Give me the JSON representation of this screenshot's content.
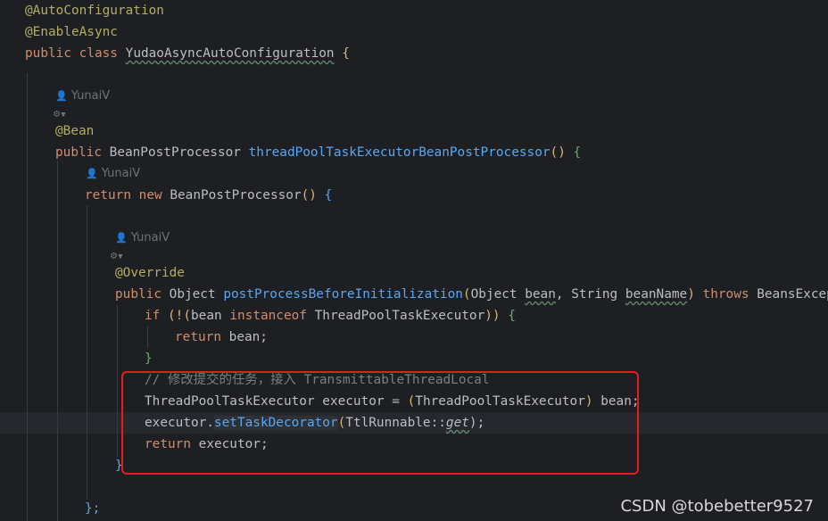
{
  "editor": {
    "hints": {
      "author": "YunaiV"
    },
    "code": {
      "ann_autoconfig": "@AutoConfiguration",
      "ann_enableasync": "@EnableAsync",
      "kw_public": "public",
      "kw_class": "class",
      "class_name": "YudaoAsyncAutoConfiguration",
      "brace_open": "{",
      "ann_bean": "@Bean",
      "type_bpp": "BeanPostProcessor",
      "method_name": "threadPoolTaskExecutorBeanPostProcessor",
      "paren_pair": "()",
      "kw_return": "return",
      "kw_new": "new",
      "ann_override": "@Override",
      "type_object": "Object",
      "method_post": "postProcessBeforeInitialization",
      "paren_open": "(",
      "param_type1": "Object",
      "param_bean": "bean",
      "comma": ",",
      "param_type2": "String",
      "param_beanname": "beanName",
      "paren_close": ")",
      "kw_throws": "throws",
      "exception_type": "BeansExcepti",
      "kw_if": "if",
      "if_open": "(!(",
      "if_bean": "bean",
      "kw_instanceof": "instanceof",
      "type_tpte": "ThreadPoolTaskExecutor",
      "if_close": "))",
      "return_bean": "bean;",
      "brace_close": "}",
      "comment": "// 修改提交的任务，接入 TransmittableThreadLocal",
      "executor_decl": "executor",
      "equals": "=",
      "cast_open": "(",
      "cast_close": ")",
      "cast_rest": "bean;",
      "executor_ref": "executor",
      "dot": ".",
      "method_settd": "setTaskDecorator",
      "ttl_class": "TtlRunnable::",
      "ttl_get": "get",
      "close_semicolon": ");",
      "return_executor": "executor;",
      "inner_close_brace": "}",
      "outer_close": "};"
    }
  },
  "watermark": "CSDN @tobebetter9527",
  "colors": {
    "background": "#1e1f22",
    "keyword": "#cf8e6d",
    "annotation": "#b3ae60",
    "method": "#56a8f5",
    "comment": "#7a7e85",
    "text": "#bcbec4",
    "highlight_box": "#e0201e"
  }
}
